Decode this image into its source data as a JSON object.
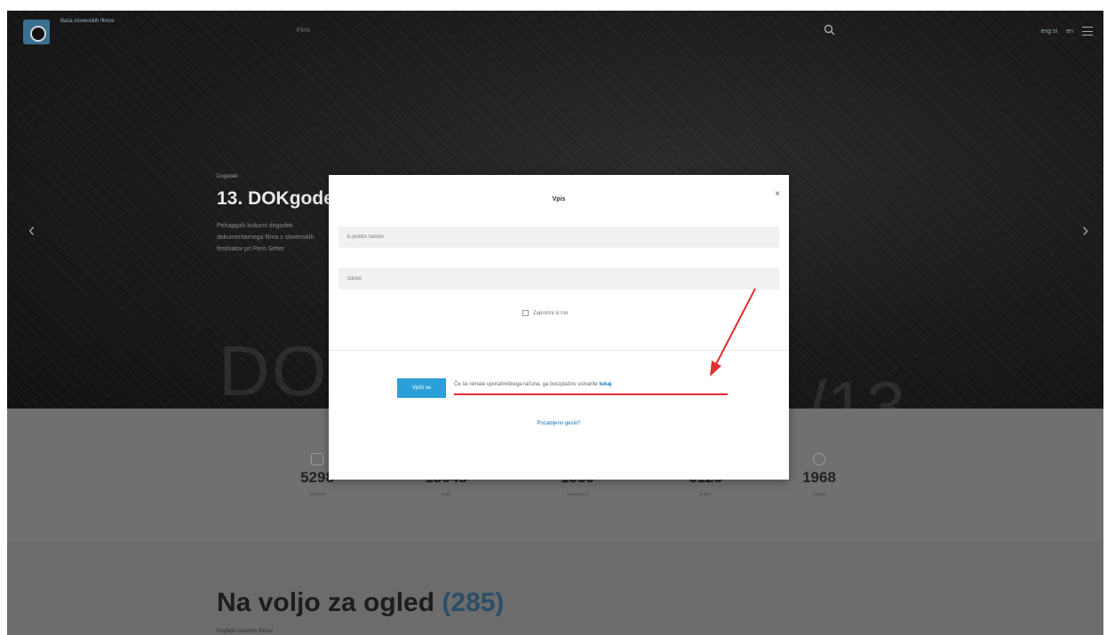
{
  "header": {
    "logo_text": "Baza slovenskih filmov",
    "nav_item": "Filmi",
    "language": "eng si",
    "lang_code": "en"
  },
  "hero": {
    "category": "Dogodek",
    "title": "13. DOKgodek",
    "description": "Prihajajoči kulturni dogodek dokumentarnega filma s slovenskih festivalov pri Pero Setter",
    "big_text": "DO",
    "big_text_right": "/13"
  },
  "stats": [
    {
      "value": "5298",
      "label": "naslovov"
    },
    {
      "value": "15643",
      "label": "oseb"
    },
    {
      "value": "1939",
      "label": "organizacij"
    },
    {
      "value": "6126",
      "label": "gradiv"
    },
    {
      "value": "1968",
      "label": "nagrad"
    }
  ],
  "lower": {
    "title": "Na voljo za ogled",
    "count": "(285)",
    "subtitle": "Poglejte celotnim filmov"
  },
  "modal": {
    "title": "Vpis",
    "close": "×",
    "email_placeholder": "E-poštni naslov",
    "password_placeholder": "Geslo",
    "remember_label": "Zapomni si me",
    "login_button": "Vpiši se",
    "register_text": "Če še nimate uporabniškega računa, ga brezplačno ustvarite",
    "register_link": "tukaj",
    "forgot_password": "Pozabljeno geslo?"
  },
  "colors": {
    "accent": "#2b9fd8",
    "link": "#1d75b8",
    "annotation": "#e03030"
  }
}
